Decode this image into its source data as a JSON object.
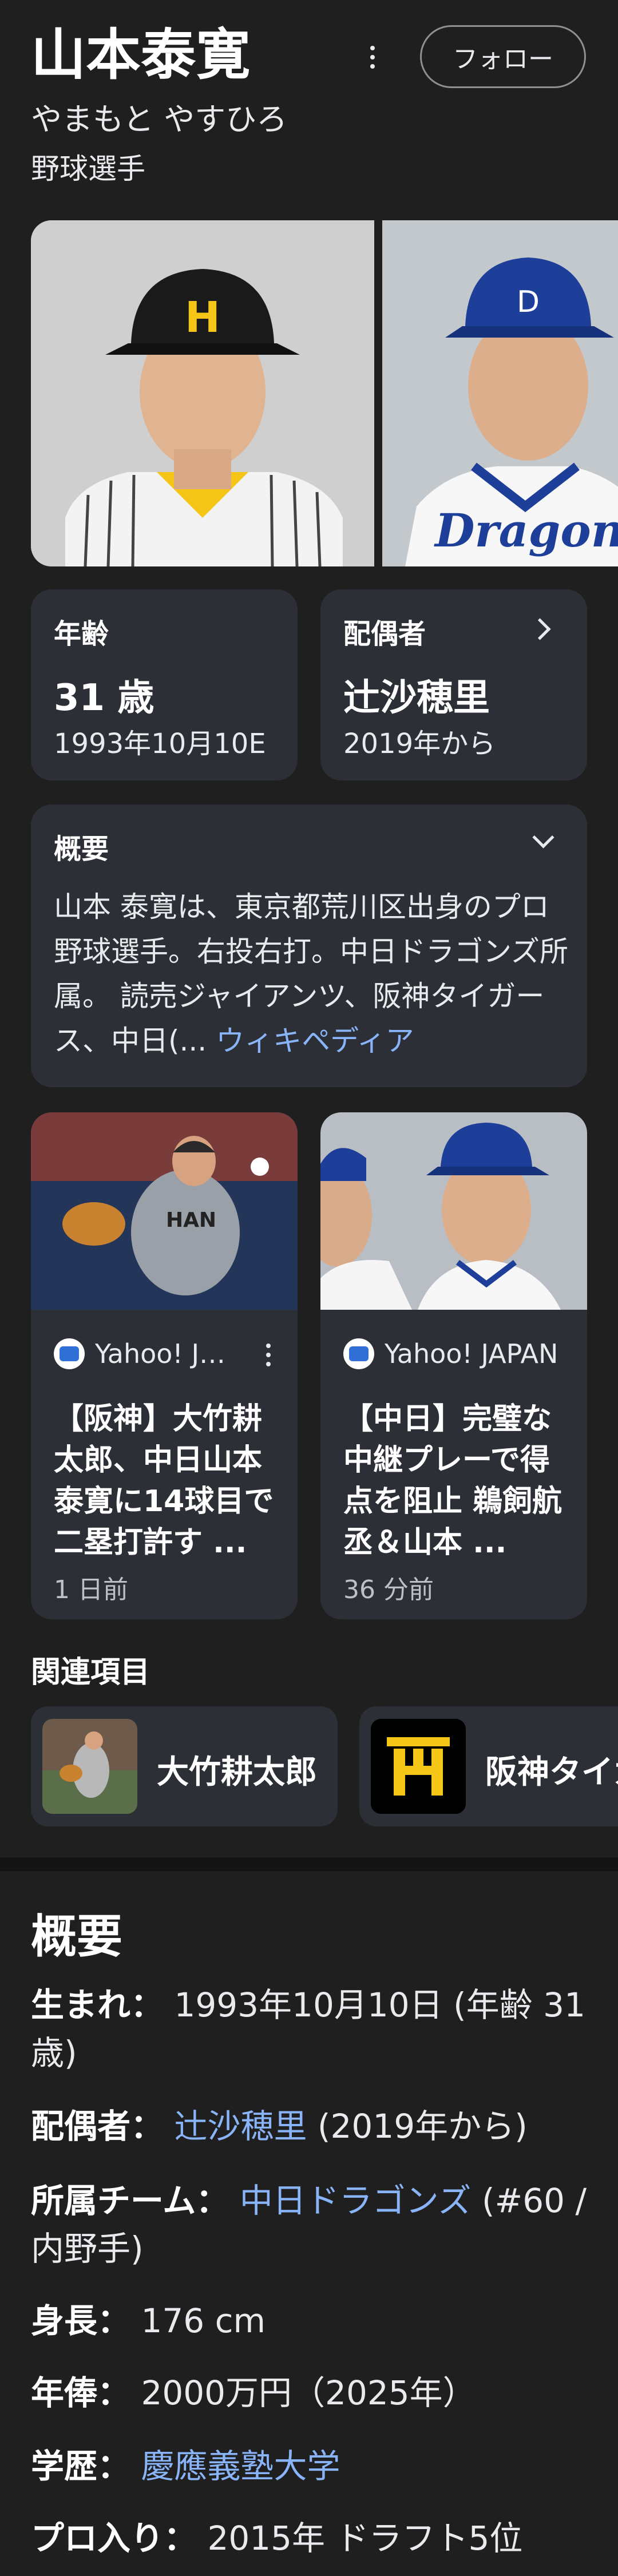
{
  "header": {
    "name": "山本泰寛",
    "reading": "やまもと やすひろ",
    "occupation": "野球選手",
    "follow_label": "フォロー"
  },
  "cards": {
    "age": {
      "label": "年齢",
      "value": "31 歳",
      "detail": "1993年10月10E"
    },
    "spouse": {
      "label": "配偶者",
      "value": "辻沙穂里",
      "detail": "2019年から"
    }
  },
  "overview_card": {
    "label": "概要",
    "text": "山本 泰寛は、東京都荒川区出身のプロ野球選手。右投右打。中日ドラゴンズ所属。 読売ジャイアンツ、阪神タイガース、中日(...",
    "source_link": "ウィキペディア"
  },
  "news": [
    {
      "source": "Yahoo! J…",
      "title": "【阪神】大竹耕太郎、中日山本泰寛に14球目で二塁打許す ...",
      "time": "1 日前"
    },
    {
      "source": "Yahoo! JAPAN",
      "title": "【中日】完璧な中継プレーで得点を阻止 鵜飼航丞＆山本 ...",
      "time": "36 分前"
    }
  ],
  "related": {
    "title": "関連項目",
    "items": [
      {
        "label": "大竹耕太郎"
      },
      {
        "label": "阪神タイガ"
      }
    ]
  },
  "overview": {
    "heading": "概要",
    "facts": [
      {
        "label": "生まれ：",
        "value": " 1993年10月10日 (年齢 31歳)"
      },
      {
        "label": "配偶者：",
        "link": " 辻沙穂里",
        "value": " (2019年から)"
      },
      {
        "label": "所属チーム：",
        "link": " 中日ドラゴンズ",
        "value": " (#60 / 内野手)"
      },
      {
        "label": "身長：",
        "value": " 176 cm"
      },
      {
        "label": "年俸：",
        "value": " 2000万円（2025年）"
      },
      {
        "label": "学歴：",
        "link": " 慶應義塾大学"
      },
      {
        "label": "プロ入り：",
        "value": " 2015年 ドラフト5位"
      }
    ]
  },
  "colors": {
    "background": "#1f1f1f",
    "card": "#2d2f36",
    "link": "#8ab4f8"
  },
  "icons": [
    "more-vert-icon",
    "chevron-right-icon",
    "chevron-down-icon",
    "more-vert-icon"
  ]
}
